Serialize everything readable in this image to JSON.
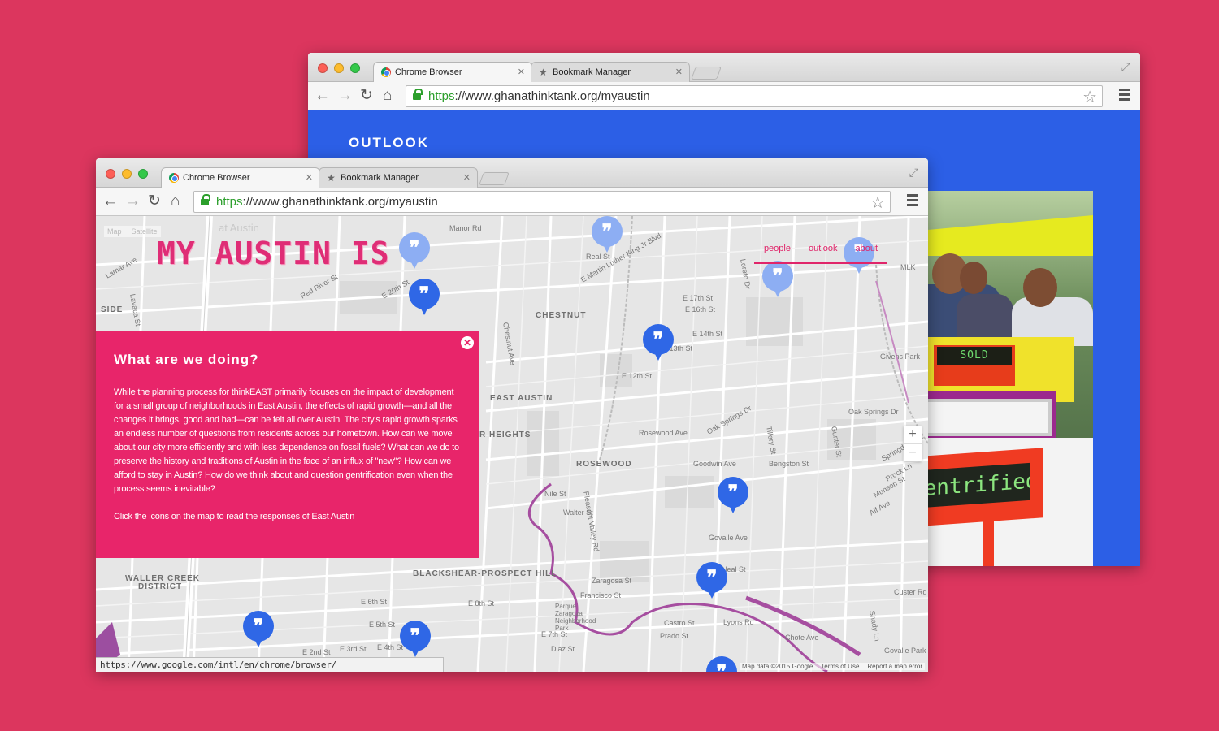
{
  "colors": {
    "background": "#dc365e",
    "accent_pink": "#e8256a",
    "pin_blue": "#2f67e6",
    "back_blue": "#2c5fe6"
  },
  "back_window": {
    "tabs": [
      {
        "label": "Chrome Browser",
        "icon": "chrome-icon",
        "active": true
      },
      {
        "label": "Bookmark Manager",
        "icon": "star-icon",
        "active": false
      }
    ],
    "url": {
      "scheme": "https",
      "rest": "://www.ghanathinktank.org/myaustin"
    },
    "page": {
      "heading": "OUTLOOK",
      "photo_signs": {
        "sold": "SOLD",
        "gentrified": "gentrified"
      }
    }
  },
  "front_window": {
    "tabs": [
      {
        "label": "Chrome Browser",
        "icon": "chrome-icon",
        "active": true
      },
      {
        "label": "Bookmark Manager",
        "icon": "star-icon",
        "active": false
      }
    ],
    "url": {
      "scheme": "https",
      "rest": "://www.ghanathinktank.org/myaustin"
    },
    "map_type": [
      "Map",
      "Satellite"
    ],
    "logo": "MY AUSTIN IS",
    "nav": [
      "people",
      "outlook",
      "about"
    ],
    "info_panel": {
      "title": "What are we doing?",
      "body": "While the planning process for thinkEAST primarily focuses on the impact of development for a small group of neighborhoods in East Austin, the effects of rapid growth—and all the changes it brings, good and bad—can be felt all over Austin. The city's rapid growth sparks an endless number of questions from residents across our hometown. How can we move about our city more efficiently and with less dependence on fossil fuels? What can we do to preserve the history and traditions of Austin in the face of an influx of \"new\"? How can we afford to stay in Austin? How do we think about and question gentrification even when the process seems inevitable?",
      "cta": "Click the icons on the map to read the responses of East Austin"
    },
    "map_labels": {
      "neighborhoods": [
        "CHESTNUT",
        "EAST AUSTIN",
        "ROSEWOOD",
        "BLACKSHEAR-PROSPECT HILL",
        "WALLER CREEK",
        "DISTRICT",
        "R HEIGHTS",
        "SIDE"
      ],
      "streets": [
        "E Martin Luther King Jr Blvd",
        "E 20th St",
        "E 17th St",
        "E 16th St",
        "E 14th St",
        "E 12th St",
        "E 13th St",
        "Rosewood Ave",
        "Oak Springs Dr",
        "Goodwin Ave",
        "Bengston St",
        "Gunter St",
        "Tillery St",
        "Nile St",
        "Walter St",
        "Zaragosa St",
        "Francisco St",
        "Govalle Ave",
        "Neal St",
        "Lyons Rd",
        "Castro St",
        "Prado St",
        "E 7th St",
        "E 6th St",
        "E 5th St",
        "E 4th St",
        "E 3rd St",
        "E 2nd St",
        "E 8th St",
        "Chestnut Ave",
        "Real St",
        "Manor Rd",
        "Loreto Dr",
        "MLK",
        "Givens Park",
        "Chote Ave",
        "Diaz St",
        "Custer Rd",
        "Springdale Rd",
        "Lamar Ave",
        "Red River St",
        "Lavaca St",
        "at Austin",
        "Pleasant Valley Rd",
        "Parque Zaragoza Neighborhood Park",
        "Oak Springs Dr",
        "Prock Ln",
        "Munson St",
        "Alf Ave",
        "Shady Ln",
        "Govalle Park"
      ]
    },
    "zoom": {
      "in": "+",
      "out": "−"
    },
    "status_url": "https://www.google.com/intl/en/chrome/browser/",
    "attribution": [
      "Map data ©2015 Google",
      "Terms of Use",
      "Report a map error"
    ]
  }
}
